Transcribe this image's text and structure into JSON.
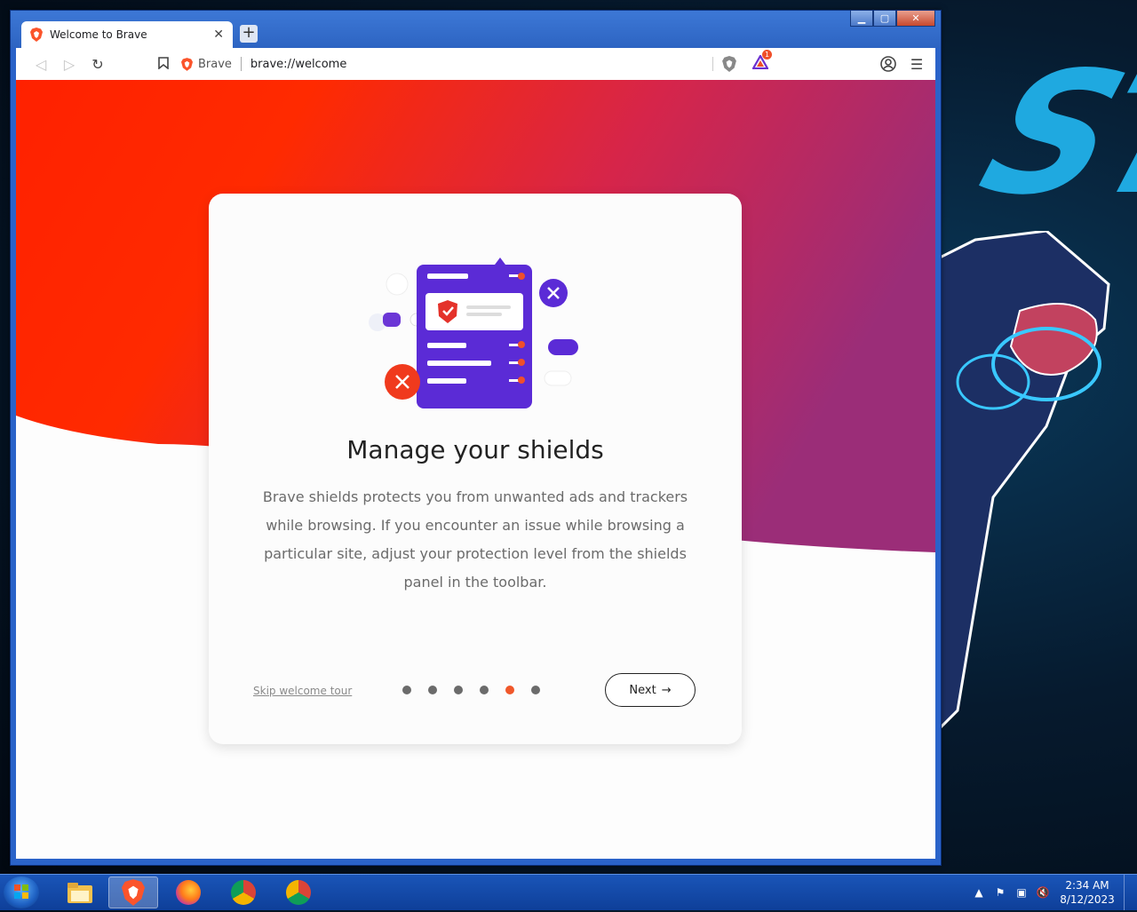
{
  "browser": {
    "tab_title": "Welcome to Brave",
    "tab_close": "✕",
    "new_tab": "+",
    "url_site": "Brave",
    "url": "brave://welcome",
    "rewards_badge": "1"
  },
  "welcome_card": {
    "title": "Manage your shields",
    "body": "Brave shields protects you from unwanted ads and trackers while browsing. If you encounter an issue while browsing a particular site, adjust your protection level from the shields panel in the toolbar.",
    "skip_label": "Skip welcome tour",
    "next_label": "Next",
    "next_arrow": "→",
    "steps_total": 6,
    "active_step": 5
  },
  "taskbar": {
    "apps": [
      "file-explorer",
      "brave",
      "firefox",
      "chrome",
      "chrome-profile"
    ],
    "active_app": "brave",
    "time": "2:34 AM",
    "date": "8/12/2023"
  },
  "colors": {
    "brave_orange": "#fb542b",
    "gradient_red": "#ff2a00",
    "gradient_purple": "#a32c75",
    "shield_purple": "#5b2bd6",
    "active_dot": "#f0572a"
  }
}
